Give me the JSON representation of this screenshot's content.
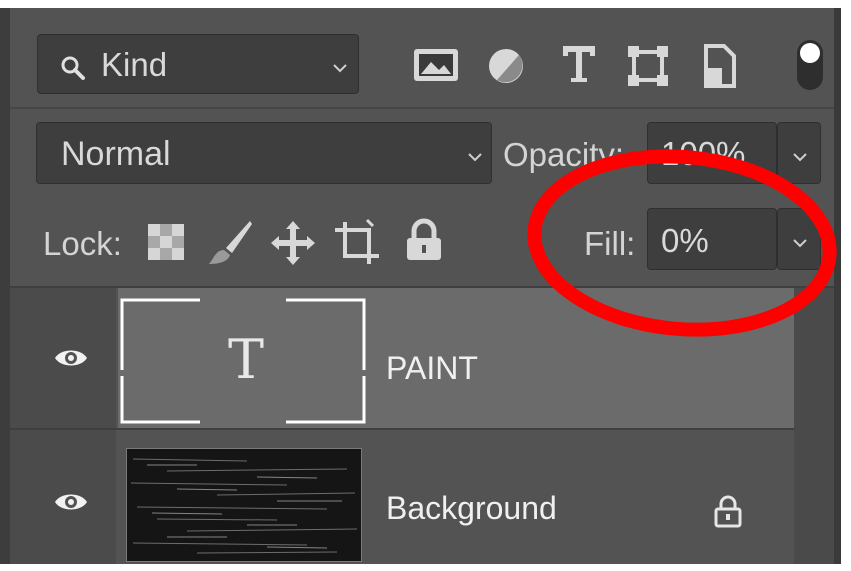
{
  "filter": {
    "search_icon": "search-icon",
    "kind_label": "Kind"
  },
  "filter_icons": [
    "image-filter-icon",
    "adjustment-filter-icon",
    "type-filter-icon",
    "shape-filter-icon",
    "smart-object-filter-icon",
    "filter-toggle-icon"
  ],
  "blend": {
    "mode": "Normal",
    "opacity_label": "Opacity:",
    "opacity_value": "100%"
  },
  "lock": {
    "label": "Lock:",
    "icons": [
      "lock-transparent-pixels-icon",
      "lock-image-pixels-icon",
      "lock-position-icon",
      "lock-artboard-icon",
      "lock-all-icon"
    ],
    "fill_label": "Fill:",
    "fill_value": "0%"
  },
  "layers": [
    {
      "name": "PAINT",
      "kind": "text",
      "thumb_glyph": "T",
      "visible": true,
      "selected": true
    },
    {
      "name": "Background",
      "kind": "image",
      "visible": true,
      "locked": true
    }
  ],
  "colors": {
    "panel": "#535353",
    "selected_row": "#6b6b6b",
    "annotation": "#ff0000"
  }
}
